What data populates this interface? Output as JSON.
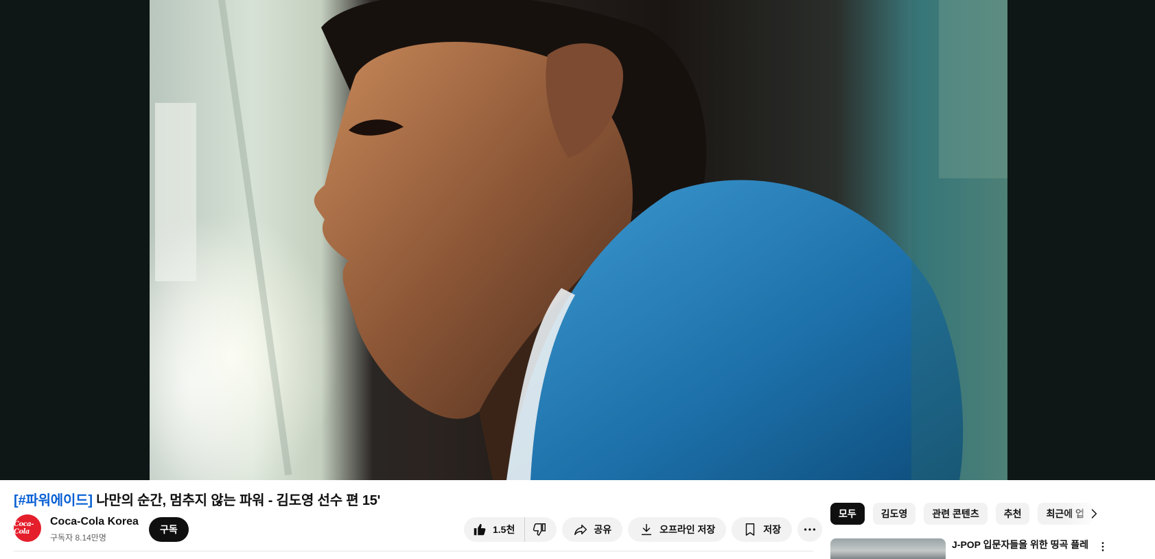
{
  "video": {
    "title_tag": "[#파워에이드]",
    "title_rest": " 나만의 순간, 멈추지 않는 파워 - 김도영 선수 편 15'"
  },
  "channel": {
    "name": "Coca-Cola Korea",
    "subscribers": "구독자 8.14만명",
    "avatar_text": "Coca-Cola",
    "subscribe_label": "구독"
  },
  "actions": {
    "like_count": "1.5천",
    "share_label": "공유",
    "download_label": "오프라인 저장",
    "save_label": "저장"
  },
  "chips": [
    "모두",
    "김도영",
    "관련 콘텐츠",
    "추천",
    "최근에 업"
  ],
  "recommendations": [
    {
      "title": "J-POP 입문자들을 위한 띵곡 플레"
    }
  ],
  "icons": {
    "like": "thumbs-up-icon",
    "dislike": "thumbs-down-icon",
    "share": "share-icon",
    "download": "download-icon",
    "save": "bookmark-icon",
    "more": "more-horizontal-icon",
    "chip_next": "chevron-right-icon",
    "rec_menu": "more-vertical-icon"
  },
  "colors": {
    "player_bg": "#0e1716",
    "brand_red": "#e41e2b",
    "link_blue": "#065fd4",
    "subscribe_bg": "#0f0f0f"
  }
}
